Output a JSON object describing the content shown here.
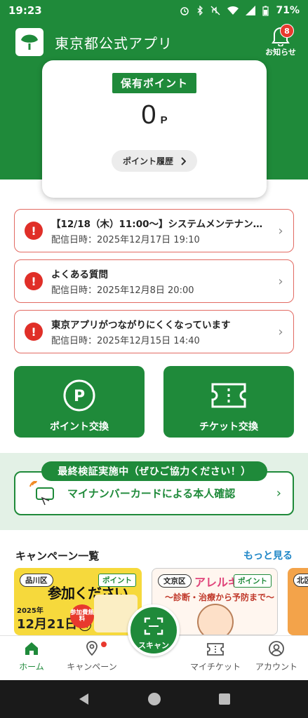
{
  "status_bar": {
    "time": "19:23",
    "battery": "71%"
  },
  "header": {
    "app_title": "東京都公式アプリ",
    "notice_label": "お知らせ",
    "notice_count": "8"
  },
  "points": {
    "tag": "保有ポイント",
    "value": "0",
    "unit": "P",
    "history_label": "ポイント履歴"
  },
  "notices": [
    {
      "title": "【12/18（木）11:00〜】システムメンテナン…",
      "date": "配信日時：2025年12月17日 19:10"
    },
    {
      "title": "よくある質問",
      "date": "配信日時：2025年12月8日 20:00"
    },
    {
      "title": "東京アプリがつながりにくくなっています",
      "date": "配信日時：2025年12月15日 14:40"
    }
  ],
  "actions": {
    "point_exchange": "ポイント交換",
    "ticket_exchange": "チケット交換"
  },
  "verification": {
    "pill": "最終検証実施中（ぜひご協力ください！）",
    "card": "マイナンバーカードによる本人確認"
  },
  "campaigns": {
    "title": "キャンペーン一覧",
    "more": "もっと見る",
    "items": [
      {
        "ward": "品川区",
        "chip": "ポイント",
        "head": "参加ください",
        "year": "2025年",
        "date": "12月21日",
        "dow": "日",
        "badge": "参加費無料"
      },
      {
        "ward": "文京区",
        "chip": "ポイント",
        "head": "アレルギー",
        "sub": "〜診断・治療から予防まで〜"
      },
      {
        "ward": "北区"
      }
    ]
  },
  "bottom_nav": {
    "home": "ホーム",
    "campaign": "キャンペーン",
    "scan": "スキャン",
    "my_ticket": "マイチケット",
    "account": "アカウント"
  },
  "colors": {
    "brand_green": "#1f8a3a",
    "alert_red": "#e02f28",
    "link_blue": "#1e86c7",
    "band_green": "#e3f1e6"
  }
}
